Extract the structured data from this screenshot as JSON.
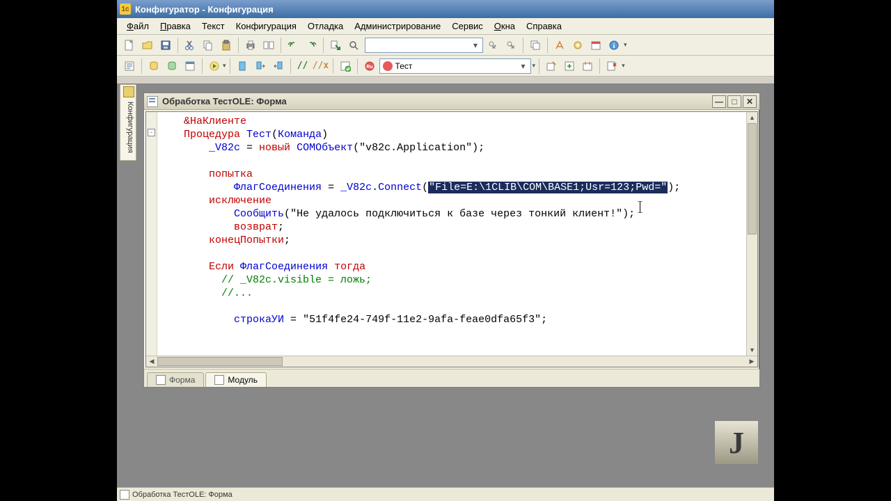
{
  "window": {
    "title": "Конфигуратор - Конфигурация"
  },
  "menu": [
    "Файл",
    "Правка",
    "Текст",
    "Конфигурация",
    "Отладка",
    "Администрирование",
    "Сервис",
    "Окна",
    "Справка"
  ],
  "menu_underline": [
    0,
    0,
    -1,
    -1,
    -1,
    -1,
    -1,
    0,
    -1
  ],
  "combo2": "Тест",
  "sidepanel": "Конфигурация",
  "editor": {
    "title": "Обработка ТестOLE: Форма",
    "tabs": [
      "Форма",
      "Модуль"
    ]
  },
  "code": {
    "l1": "&НаКлиенте",
    "l2a": "Процедура",
    "l2b": "Тест",
    "l2c": "Команда",
    "l3a": "_V82c",
    "l3b": "новый",
    "l3c": "COMОбъект",
    "l3d": "\"v82c.Application\"",
    "l4": "попытка",
    "l5a": "ФлагСоединения",
    "l5b": "_V82c",
    "l5c": "Connect",
    "l5d": "\"File=E:\\1CLIB\\COM\\BASE1;Usr=123;Pwd=\"",
    "l6": "исключение",
    "l7a": "Сообщить",
    "l7b": "\"Не удалось подключиться к базе через тонкий клиент!\"",
    "l8": "возврат",
    "l9": "конецПопытки",
    "l10a": "Если",
    "l10b": "ФлагСоединения",
    "l10c": "тогда",
    "l11": "// _V82c.visible = ложь;",
    "l12": "//...",
    "l13a": "строкаУИ",
    "l13b": "\"51f4fe24-749f-11e2-9afa-feae0dfa65f3\""
  },
  "status": "Обработка ТестOLE: Форма"
}
